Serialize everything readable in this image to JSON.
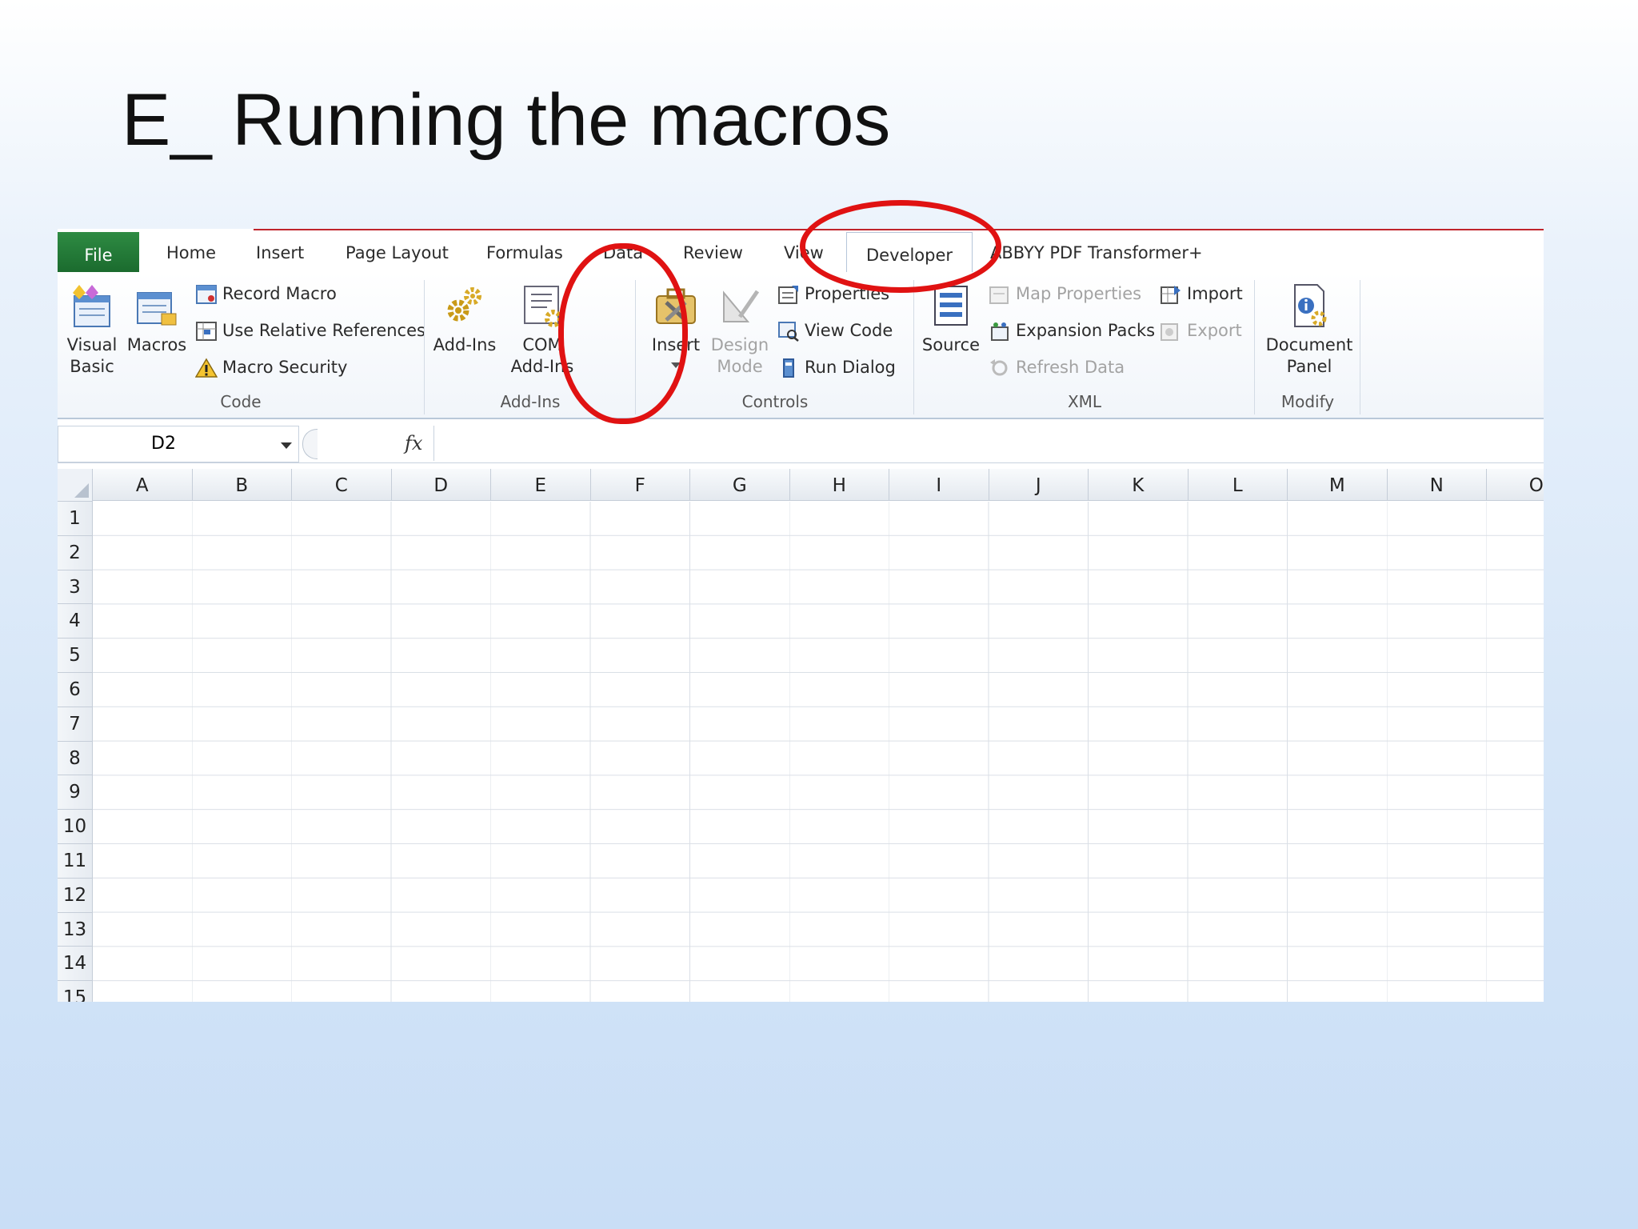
{
  "slide": {
    "title": "E_ Running the macros"
  },
  "tabs": [
    {
      "label": "File"
    },
    {
      "label": "Home"
    },
    {
      "label": "Insert"
    },
    {
      "label": "Page Layout"
    },
    {
      "label": "Formulas"
    },
    {
      "label": "Data"
    },
    {
      "label": "Review"
    },
    {
      "label": "View"
    },
    {
      "label": "Developer"
    },
    {
      "label": "ABBYY PDF Transformer+"
    }
  ],
  "ribbon": {
    "code": {
      "label": "Code",
      "visual_basic_1": "Visual",
      "visual_basic_2": "Basic",
      "macros": "Macros",
      "record_macro": "Record Macro",
      "use_relative": "Use Relative References",
      "macro_security": "Macro Security"
    },
    "addins": {
      "label": "Add-Ins",
      "addins": "Add-Ins",
      "com_1": "COM",
      "com_2": "Add-Ins"
    },
    "controls": {
      "label": "Controls",
      "insert": "Insert",
      "design_1": "Design",
      "design_2": "Mode",
      "properties": "Properties",
      "view_code": "View Code",
      "run_dialog": "Run Dialog"
    },
    "xml": {
      "label": "XML",
      "source": "Source",
      "map_properties": "Map Properties",
      "expansion_packs": "Expansion Packs",
      "refresh_data": "Refresh Data",
      "import": "Import",
      "export": "Export"
    },
    "modify": {
      "label": "Modify",
      "doc_1": "Document",
      "doc_2": "Panel"
    }
  },
  "formula_bar": {
    "name_box": "D2",
    "fx": "fx"
  },
  "grid": {
    "columns": [
      "A",
      "B",
      "C",
      "D",
      "E",
      "F",
      "G",
      "H",
      "I",
      "J",
      "K",
      "L",
      "M",
      "N",
      "O"
    ],
    "rows": [
      "1",
      "2",
      "3",
      "4",
      "5",
      "6",
      "7",
      "8",
      "9",
      "10",
      "11",
      "12",
      "13",
      "14",
      "15"
    ]
  },
  "colors": {
    "highlight": "#e01212",
    "file_tab": "#1f7a34"
  }
}
